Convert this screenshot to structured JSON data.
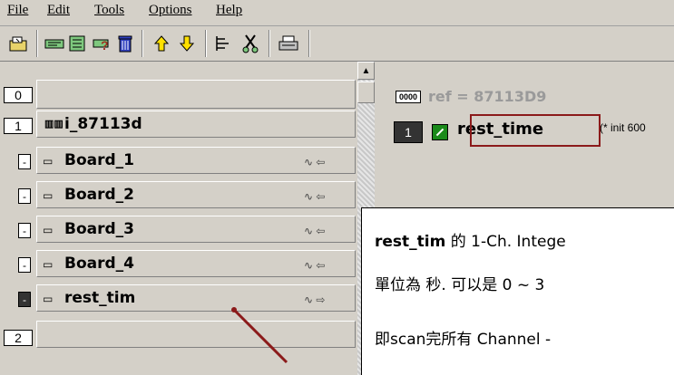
{
  "menu": [
    "File",
    "Edit",
    "Tools",
    "Options",
    "Help"
  ],
  "toolbar_icons": [
    "open-folder-icon",
    "plc-read-icon",
    "plc-write-icon",
    "plc-compare-icon",
    "delete-icon",
    "arrow-up-icon",
    "arrow-down-icon",
    "tree-icon",
    "cut-icon",
    "print-icon"
  ],
  "left": {
    "rows": [
      {
        "num": "0",
        "label": ""
      },
      {
        "num": "1",
        "icon": "ⅢⅢ",
        "label": "i_87113d"
      },
      {
        "bullet": "-",
        "label": "Board_1",
        "tail": "∿ ⇦"
      },
      {
        "bullet": "-",
        "label": "Board_2",
        "tail": "∿ ⇦"
      },
      {
        "bullet": "-",
        "label": "Board_3",
        "tail": "∿ ⇦"
      },
      {
        "bullet": "-",
        "label": "Board_4",
        "tail": "∿ ⇦"
      },
      {
        "bullet": "-",
        "label": "rest_tim",
        "tail": "∿ ⇨",
        "selected": true
      },
      {
        "num": "2",
        "label": ""
      }
    ]
  },
  "right": {
    "ref_tag": "0000",
    "ref": "ref = 87113D9",
    "item_num": "1",
    "item_name": "rest_time",
    "comment": "(* init 600"
  },
  "note": {
    "line1_bold": "rest_tim",
    "line1_rest": "的  1-Ch. Intege",
    "line2": "單位為  秒.  可以是  0 ~ 3",
    "line3": "即scan完所有  Channel  -"
  },
  "colors": {
    "highlight": "#8b1a1a",
    "bg": "#d4d0c8"
  }
}
